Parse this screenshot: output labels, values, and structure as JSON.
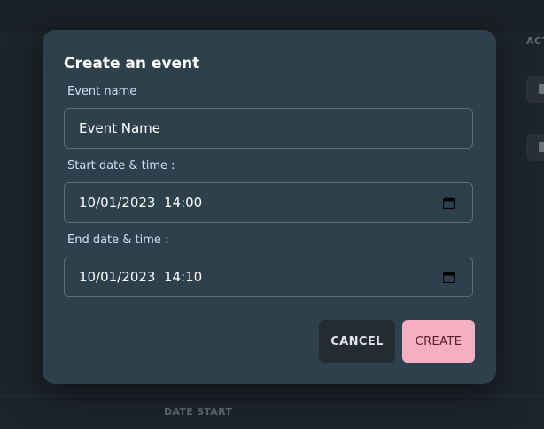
{
  "background": {
    "column_header_right": "ACT",
    "column_header_date_start": "DATE START"
  },
  "dialog": {
    "title": "Create an event",
    "fields": [
      {
        "label": "Event name",
        "value": "Event Name"
      },
      {
        "label": "Start date & time :",
        "value": "10/01/2023  14:00",
        "icon": "calendar-icon"
      },
      {
        "label": "End date & time :",
        "value": "10/01/2023  14:10",
        "icon": "calendar-icon"
      }
    ],
    "cancel_label": "CANCEL",
    "create_label": "CREATE"
  },
  "colors": {
    "dialog_bg": "#2e404c",
    "label": "#c9e3f5",
    "create_button": "#f4afc2",
    "cancel_button": "#242c31"
  }
}
